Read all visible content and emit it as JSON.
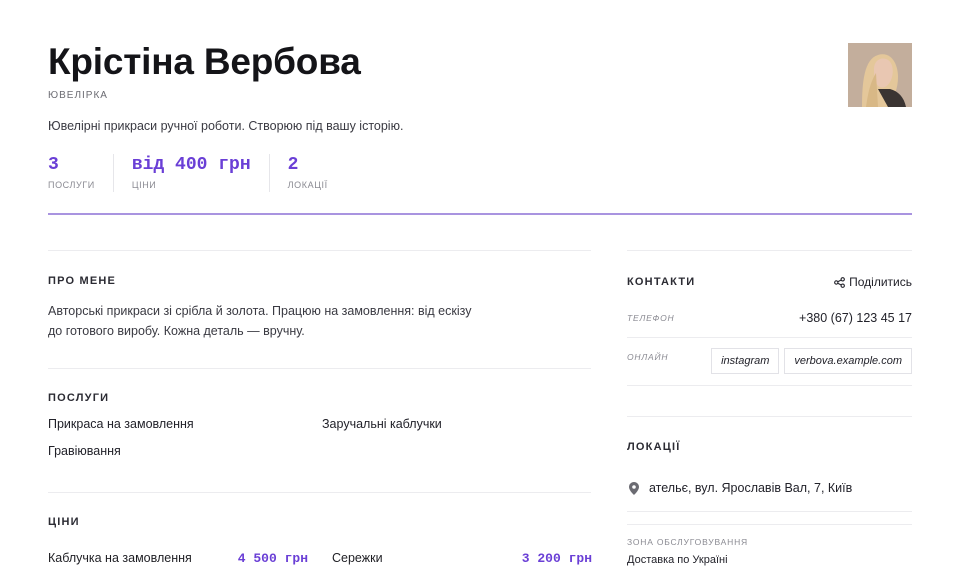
{
  "profile": {
    "name": "Крістіна Вербова",
    "category": "ЮВЕЛІРКА",
    "tagline": "Ювелірні прикраси ручної роботи. Створюю під вашу історію.",
    "avatar_icon": "person-photo"
  },
  "stats": [
    {
      "value": "3",
      "label": "ПОСЛУГИ"
    },
    {
      "value": "від 400 грн",
      "label": "ЦІНИ"
    },
    {
      "value": "2",
      "label": "ЛОКАЦІЇ"
    }
  ],
  "about": {
    "title": "ПРО МЕНЕ",
    "text": "Авторські прикраси зі срібла й золота. Працюю на замовлення: від ескізу до готового виробу. Кожна деталь — вручну."
  },
  "services": {
    "title": "ПОСЛУГИ",
    "items": [
      "Прикраса на замовлення",
      "Заручальні каблучки",
      "Гравіювання"
    ]
  },
  "prices": {
    "title": "ЦІНИ",
    "items": [
      {
        "name": "Каблучка на замовлення",
        "price": "4 500 грн"
      },
      {
        "name": "Сережки",
        "price": "3 200 грн"
      }
    ]
  },
  "contacts": {
    "title": "КОНТАКТИ",
    "share_label": "Поділитись",
    "phone_label": "ТЕЛЕФОН",
    "phone": "+380 (67) 123 45 17",
    "online_label": "ОНЛАЙН",
    "links": [
      "instagram",
      "verbova.example.com"
    ]
  },
  "locations": {
    "title": "ЛОКАЦІЇ",
    "address": "ательє, вул. Ярославів Вал, 7, Київ",
    "zone_label": "ЗОНА ОБСЛУГОВУВАННЯ",
    "zone_value": "Доставка по Україні"
  },
  "colors": {
    "accent": "#6a3fd6",
    "accent_line": "#a994e0"
  }
}
